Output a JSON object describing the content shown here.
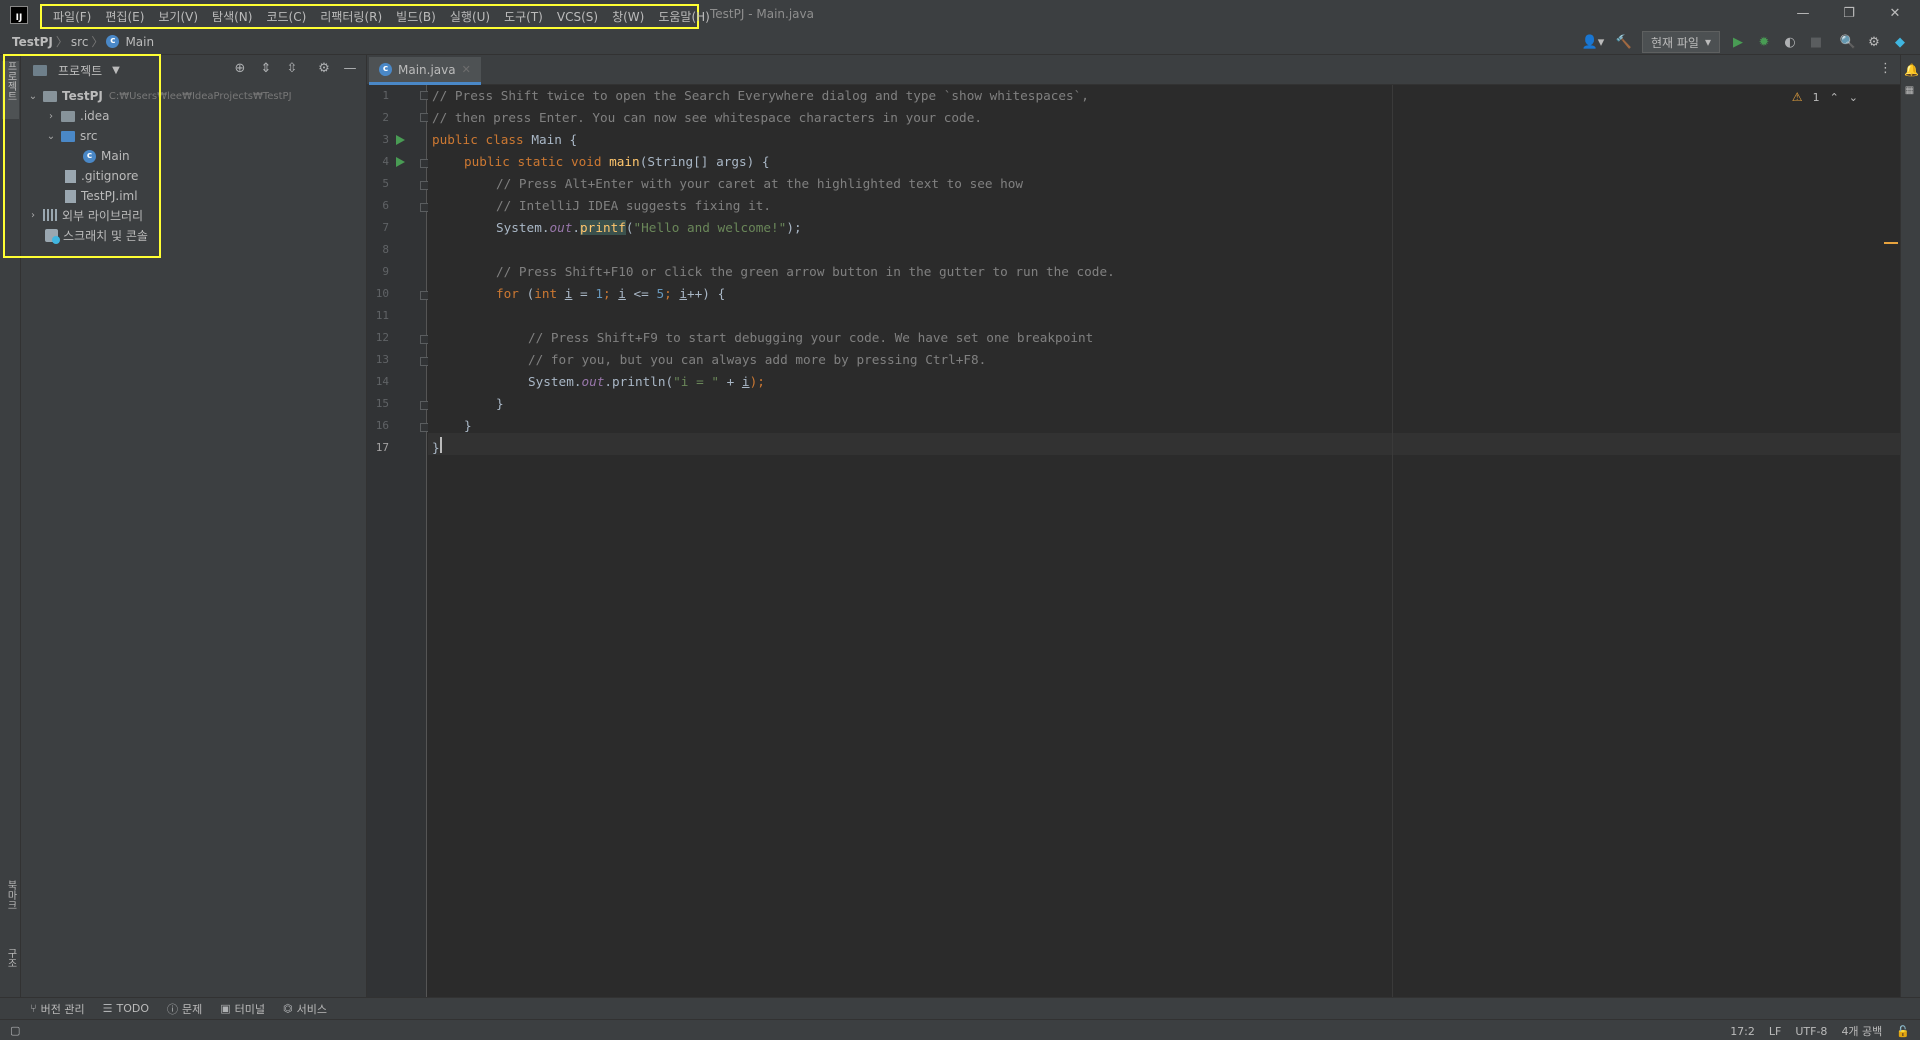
{
  "titlebar": {
    "logo": "IJ",
    "window_title": "TestPJ - Main.java",
    "menu": [
      "파일(F)",
      "편집(E)",
      "보기(V)",
      "탐색(N)",
      "코드(C)",
      "리팩터링(R)",
      "빌드(B)",
      "실행(U)",
      "도구(T)",
      "VCS(S)",
      "창(W)",
      "도움말(H)"
    ],
    "controls": {
      "minimize": "—",
      "restore": "❐",
      "close": "✕"
    }
  },
  "navbar": {
    "breadcrumbs": [
      "TestPJ",
      "src",
      "Main"
    ],
    "run_config": "현재 파일"
  },
  "left_strip": {
    "project_tab": "프로젝트",
    "bookmarks_tab": "북마크",
    "structure_tab": "구조"
  },
  "project_panel": {
    "title": "프로젝트",
    "tree": [
      {
        "label": "TestPJ",
        "hint": "C:₩Users₩lee₩IdeaProjects₩TestPJ",
        "type": "project",
        "expanded": true
      },
      {
        "label": ".idea",
        "type": "folder",
        "expanded": false
      },
      {
        "label": "src",
        "type": "source-folder",
        "expanded": true
      },
      {
        "label": "Main",
        "type": "class"
      },
      {
        "label": ".gitignore",
        "type": "file"
      },
      {
        "label": "TestPJ.iml",
        "type": "file"
      },
      {
        "label": "외부 라이브러리",
        "type": "library",
        "expanded": false
      },
      {
        "label": "스크래치 및 콘솔",
        "type": "scratch"
      }
    ]
  },
  "editor": {
    "tab": "Main.java",
    "line_numbers": [
      "1",
      "2",
      "3",
      "4",
      "5",
      "6",
      "7",
      "8",
      "9",
      "10",
      "11",
      "12",
      "13",
      "14",
      "15",
      "16",
      "17"
    ],
    "current_line": "17",
    "warnings_count": "1",
    "code": {
      "l1": "// Press Shift twice to open the Search Everywhere dialog and type `show whitespaces`,",
      "l2": "// then press Enter. You can now see whitespace characters in your code.",
      "l3_kw": "public class ",
      "l3_name": "Main {",
      "l4_kw": "public static void ",
      "l4_fn": "main",
      "l4_rest": "(String[] args) {",
      "l5": "// Press Alt+Enter with your caret at the highlighted text to see how",
      "l6": "// IntelliJ IDEA suggests fixing it.",
      "l7_a": "System.",
      "l7_out": "out",
      "l7_dot": ".",
      "l7_fn": "printf",
      "l7_paren": "(",
      "l7_str": "\"Hello and welcome!\"",
      "l7_end": ");",
      "l9": "// Press Shift+F10 or click the green arrow button in the gutter to run the code.",
      "l10_for": "for ",
      "l10_p": "(",
      "l10_int": "int ",
      "l10_i1": "i",
      "l10_eq": " = ",
      "l10_one": "1",
      "l10_semi": "; ",
      "l10_i2": "i",
      "l10_le": " <= ",
      "l10_five": "5",
      "l10_semi2": "; ",
      "l10_i3": "i",
      "l10_end": "++) {",
      "l12": "// Press Shift+F9 to start debugging your code. We have set one breakpoint",
      "l13": "// for you, but you can always add more by pressing Ctrl+F8.",
      "l14_a": "System.",
      "l14_out": "out",
      "l14_b": ".println(",
      "l14_str": "\"i = \"",
      "l14_plus": " + ",
      "l14_i": "i",
      "l14_end": ");",
      "l15": "}",
      "l16": "}",
      "l17": "}"
    }
  },
  "tool_windows": [
    {
      "label": "버전 관리",
      "icon": "branch-icon"
    },
    {
      "label": "TODO",
      "icon": "list-icon"
    },
    {
      "label": "문제",
      "icon": "info-icon"
    },
    {
      "label": "터미널",
      "icon": "terminal-icon"
    },
    {
      "label": "서비스",
      "icon": "services-icon"
    }
  ],
  "status": {
    "position": "17:2",
    "line_sep": "LF",
    "encoding": "UTF-8",
    "indent": "4개 공백"
  },
  "colors": {
    "highlight_box": "#ffff33",
    "run_green": "#499c54",
    "accent_blue": "#4a88c7"
  }
}
